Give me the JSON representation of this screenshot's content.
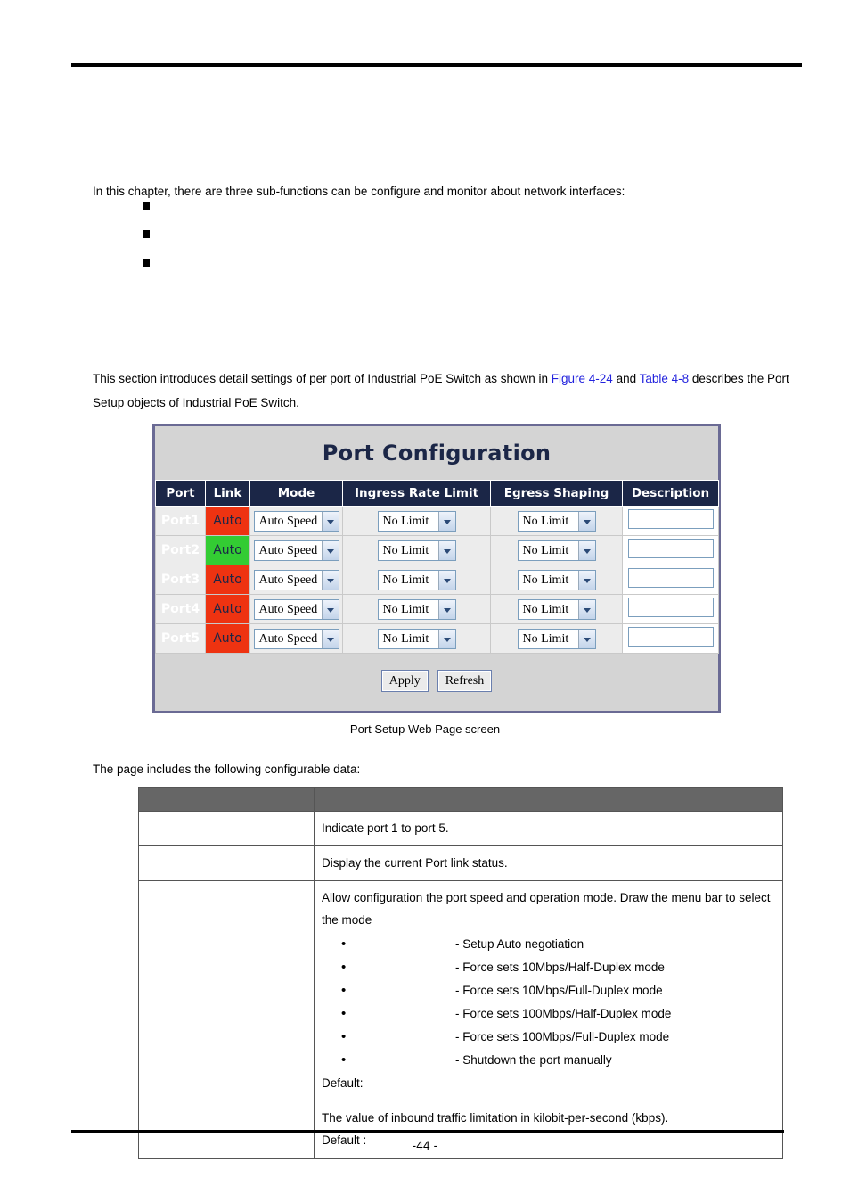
{
  "document": {
    "page_number": "-44 -",
    "intro_paragraph": "In this chapter, there are three sub-functions can be configure and monitor about network interfaces:",
    "sub_function_bullets": [
      "",
      "",
      ""
    ],
    "section_text_before_fig_link": "This section introduces detail settings of per port of Industrial PoE Switch as shown in ",
    "figure_link": "Figure 4-24",
    "section_text_between_links": " and ",
    "table_link": "Table 4-8",
    "section_text_after_links": " describes the Port Setup objects of Industrial PoE Switch.",
    "figure_caption": "Port Setup Web Page screen",
    "lead_in": "The page includes the following configurable data:"
  },
  "figure": {
    "title": "Port Configuration",
    "columns": [
      "Port",
      "Link",
      "Mode",
      "Ingress Rate Limit",
      "Egress Shaping",
      "Description"
    ],
    "rows": [
      {
        "port": "Port1",
        "link": "Auto",
        "link_state": "down",
        "mode": "Auto Speed",
        "ingress": "No Limit",
        "egress": "No Limit",
        "description": ""
      },
      {
        "port": "Port2",
        "link": "Auto",
        "link_state": "up",
        "mode": "Auto Speed",
        "ingress": "No Limit",
        "egress": "No Limit",
        "description": ""
      },
      {
        "port": "Port3",
        "link": "Auto",
        "link_state": "down",
        "mode": "Auto Speed",
        "ingress": "No Limit",
        "egress": "No Limit",
        "description": ""
      },
      {
        "port": "Port4",
        "link": "Auto",
        "link_state": "down",
        "mode": "Auto Speed",
        "ingress": "No Limit",
        "egress": "No Limit",
        "description": ""
      },
      {
        "port": "Port5",
        "link": "Auto",
        "link_state": "down",
        "mode": "Auto Speed",
        "ingress": "No Limit",
        "egress": "No Limit",
        "description": ""
      }
    ],
    "buttons": {
      "apply": "Apply",
      "refresh": "Refresh"
    },
    "colors": {
      "frame_border": "#6a6a94",
      "title_bar_bg": "#d4d4d4",
      "title_text": "#1b2647",
      "header_bg": "#1b2647",
      "header_text": "#ffffff",
      "link_down": "#ee3311",
      "link_up": "#33cc33",
      "cell_bg": "#ececec"
    }
  },
  "description_table": {
    "header": {
      "object": "",
      "description": ""
    },
    "rows": [
      {
        "object": "",
        "description": "Indicate port 1 to port 5."
      },
      {
        "object": "",
        "description": "Display the current Port link status."
      },
      {
        "object": "",
        "description": "Allow configuration the port speed and operation mode. Draw the menu bar to select the mode",
        "bullets": [
          "- Setup Auto negotiation",
          "- Force sets 10Mbps/Half-Duplex mode",
          "- Force sets 10Mbps/Full-Duplex mode",
          "- Force sets 100Mbps/Half-Duplex mode",
          "- Force sets 100Mbps/Full-Duplex mode",
          "- Shutdown the port manually"
        ],
        "default": "Default:"
      },
      {
        "object": "",
        "description": "The value of inbound traffic limitation in kilobit-per-second (kbps).",
        "default": "Default :"
      }
    ]
  }
}
